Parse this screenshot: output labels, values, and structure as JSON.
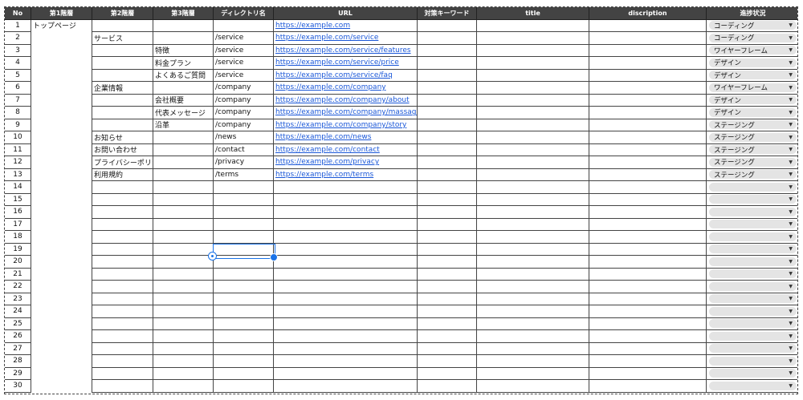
{
  "header": {
    "no": "No",
    "level1": "第1階層",
    "level2": "第2階層",
    "level3": "第3階層",
    "directory": "ディレクトリ名",
    "url": "URL",
    "keyword": "対策キーワード",
    "title": "title",
    "description": "discription",
    "status": "進捗状況"
  },
  "rows": [
    {
      "no": "1",
      "l1": "トップページ",
      "l2": "",
      "l3": "",
      "dir": "",
      "url": "https://example.com",
      "status": "コーディング"
    },
    {
      "no": "2",
      "l1": "",
      "l2": "サービス",
      "l3": "",
      "dir": "/service",
      "url": "https://example.com/service",
      "status": "コーディング"
    },
    {
      "no": "3",
      "l1": "",
      "l2": "",
      "l3": "特徴",
      "dir": "/service",
      "url": "https://example.com/service/features",
      "status": "ワイヤーフレーム"
    },
    {
      "no": "4",
      "l1": "",
      "l2": "",
      "l3": "料金プラン",
      "dir": "/service",
      "url": "https://example.com/service/price",
      "status": "デザイン"
    },
    {
      "no": "5",
      "l1": "",
      "l2": "",
      "l3": "よくあるご質問",
      "dir": "/service",
      "url": "https://example.com/service/faq",
      "status": "デザイン"
    },
    {
      "no": "6",
      "l1": "",
      "l2": "企業情報",
      "l3": "",
      "dir": "/company",
      "url": "https://example.com/company",
      "status": "ワイヤーフレーム"
    },
    {
      "no": "7",
      "l1": "",
      "l2": "",
      "l3": "会社概要",
      "dir": "/company",
      "url": "https://example.com/company/about",
      "status": "デザイン"
    },
    {
      "no": "8",
      "l1": "",
      "l2": "",
      "l3": "代表メッセージ",
      "dir": "/company",
      "url": "https://example.com/company/massage",
      "status": "デザイン"
    },
    {
      "no": "9",
      "l1": "",
      "l2": "",
      "l3": "沿革",
      "dir": "/company",
      "url": "https://example.com/company/story",
      "status": "ステージング"
    },
    {
      "no": "10",
      "l1": "",
      "l2": "お知らせ",
      "l3": "",
      "dir": "/news",
      "url": "https://example.com/news",
      "status": "ステージング"
    },
    {
      "no": "11",
      "l1": "",
      "l2": "お問い合わせ",
      "l3": "",
      "dir": "/contact",
      "url": "https://example.com/contact",
      "status": "ステージング"
    },
    {
      "no": "12",
      "l1": "",
      "l2": "プライバシーポリシー",
      "l3": "",
      "dir": "/privacy",
      "url": "https://example.com/privacy",
      "status": "ステージング"
    },
    {
      "no": "13",
      "l1": "",
      "l2": "利用規約",
      "l3": "",
      "dir": "/terms",
      "url": "https://example.com/terms",
      "status": "ステージング"
    },
    {
      "no": "14",
      "l1": "",
      "l2": "",
      "l3": "",
      "dir": "",
      "url": "",
      "status": ""
    },
    {
      "no": "15",
      "l1": "",
      "l2": "",
      "l3": "",
      "dir": "",
      "url": "",
      "status": ""
    },
    {
      "no": "16",
      "l1": "",
      "l2": "",
      "l3": "",
      "dir": "",
      "url": "",
      "status": ""
    },
    {
      "no": "17",
      "l1": "",
      "l2": "",
      "l3": "",
      "dir": "",
      "url": "",
      "status": ""
    },
    {
      "no": "18",
      "l1": "",
      "l2": "",
      "l3": "",
      "dir": "",
      "url": "",
      "status": ""
    },
    {
      "no": "19",
      "l1": "",
      "l2": "",
      "l3": "",
      "dir": "",
      "url": "",
      "status": ""
    },
    {
      "no": "20",
      "l1": "",
      "l2": "",
      "l3": "",
      "dir": "",
      "url": "",
      "status": ""
    },
    {
      "no": "21",
      "l1": "",
      "l2": "",
      "l3": "",
      "dir": "",
      "url": "",
      "status": ""
    },
    {
      "no": "22",
      "l1": "",
      "l2": "",
      "l3": "",
      "dir": "",
      "url": "",
      "status": ""
    },
    {
      "no": "23",
      "l1": "",
      "l2": "",
      "l3": "",
      "dir": "",
      "url": "",
      "status": ""
    },
    {
      "no": "24",
      "l1": "",
      "l2": "",
      "l3": "",
      "dir": "",
      "url": "",
      "status": ""
    },
    {
      "no": "25",
      "l1": "",
      "l2": "",
      "l3": "",
      "dir": "",
      "url": "",
      "status": ""
    },
    {
      "no": "26",
      "l1": "",
      "l2": "",
      "l3": "",
      "dir": "",
      "url": "",
      "status": ""
    },
    {
      "no": "27",
      "l1": "",
      "l2": "",
      "l3": "",
      "dir": "",
      "url": "",
      "status": ""
    },
    {
      "no": "28",
      "l1": "",
      "l2": "",
      "l3": "",
      "dir": "",
      "url": "",
      "status": ""
    },
    {
      "no": "29",
      "l1": "",
      "l2": "",
      "l3": "",
      "dir": "",
      "url": "",
      "status": ""
    },
    {
      "no": "30",
      "l1": "",
      "l2": "",
      "l3": "",
      "dir": "",
      "url": "",
      "status": ""
    }
  ],
  "selection": {
    "row": 19,
    "column": "directory"
  },
  "icons": {
    "dropdown": "chevron-down-icon",
    "fill_handle": "fill-handle-icon"
  },
  "colors": {
    "header_bg": "#434343",
    "link": "#1a57d8",
    "selection": "#1a73e8",
    "chip_bg": "#e4e4e4"
  }
}
